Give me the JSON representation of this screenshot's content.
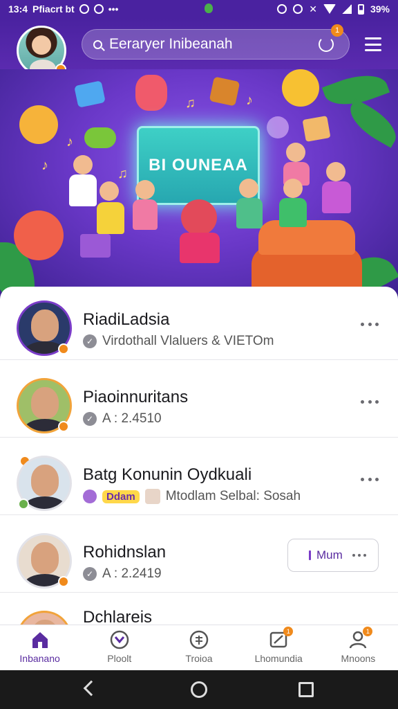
{
  "status_bar": {
    "time": "13:4",
    "carrier": "Pfiacrt bt",
    "battery": "39%"
  },
  "header": {
    "search_placeholder": "Eeraryer Inibeanah",
    "notification_badge": "1"
  },
  "banner": {
    "screen_text": "BI OUNEAA"
  },
  "list": [
    {
      "name": "RiadiLadsia",
      "subtitle": "Virdothall Vlaluers & VIETOm"
    },
    {
      "name": "Piaoinnuritans",
      "subtitle": "A : 2.4510"
    },
    {
      "name": "Batg Konunin Oydkuali",
      "chip": "Ddam",
      "subtitle": "Mtodlam Selbal: Sosah"
    },
    {
      "name": "Rohidnslan",
      "subtitle": "A : 2.2419",
      "button_label": "Mum"
    },
    {
      "name": "Dchlareis"
    }
  ],
  "bottom_nav": [
    {
      "label": "Inbanano",
      "icon": "home-icon",
      "active": true
    },
    {
      "label": "Ploolt",
      "icon": "shield-icon",
      "active": false
    },
    {
      "label": "Troioa",
      "icon": "chat-icon",
      "active": false
    },
    {
      "label": "Lhomundia",
      "icon": "send-icon",
      "active": false,
      "badge": "1"
    },
    {
      "label": "Mnoons",
      "icon": "profile-icon",
      "active": false,
      "badge": "1"
    }
  ],
  "colors": {
    "brand": "#5a2ca0",
    "accent": "#f08a1c"
  }
}
